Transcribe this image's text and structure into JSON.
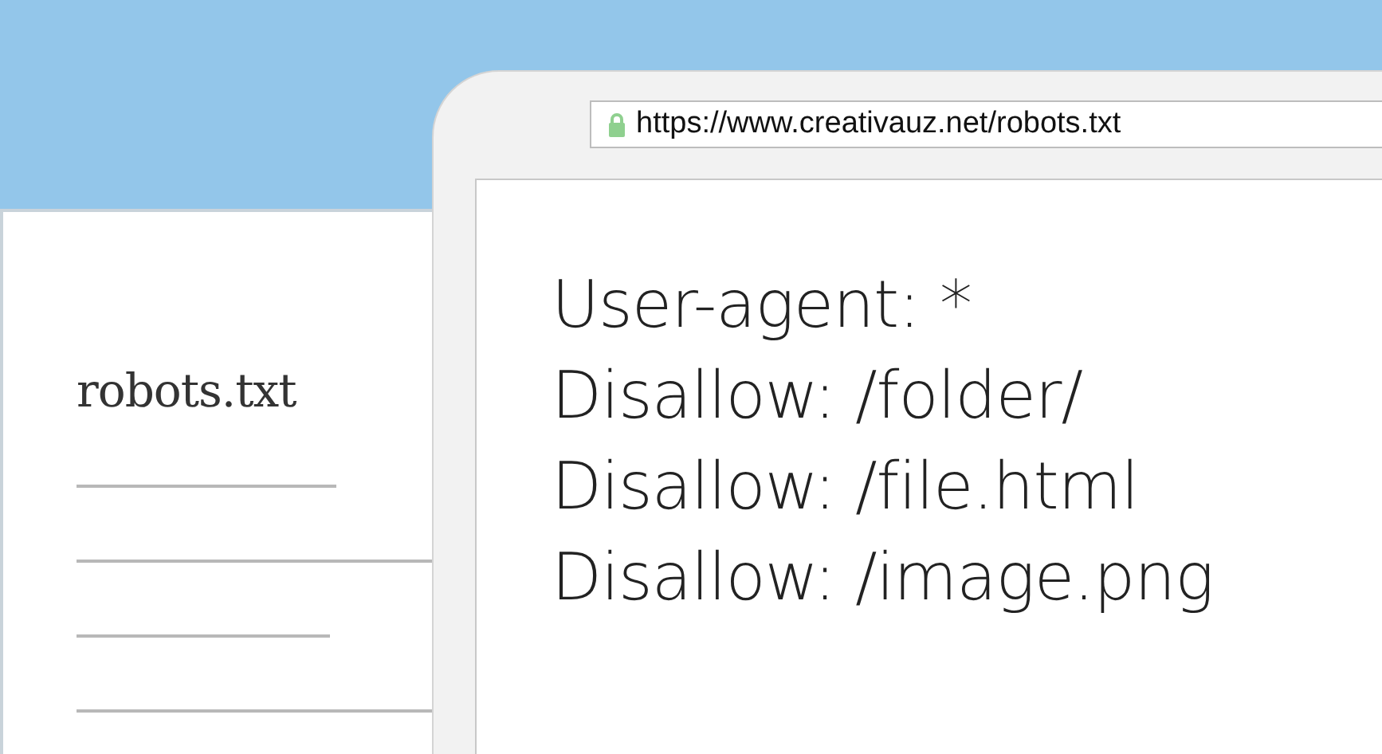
{
  "document": {
    "title": "robots.txt"
  },
  "browser": {
    "url": "https://www.creativauz.net/robots.txt",
    "secure": true,
    "lines": [
      "User-agent: *",
      "Disallow: /folder/",
      "Disallow: /file.html",
      "Disallow: /image.png"
    ]
  }
}
